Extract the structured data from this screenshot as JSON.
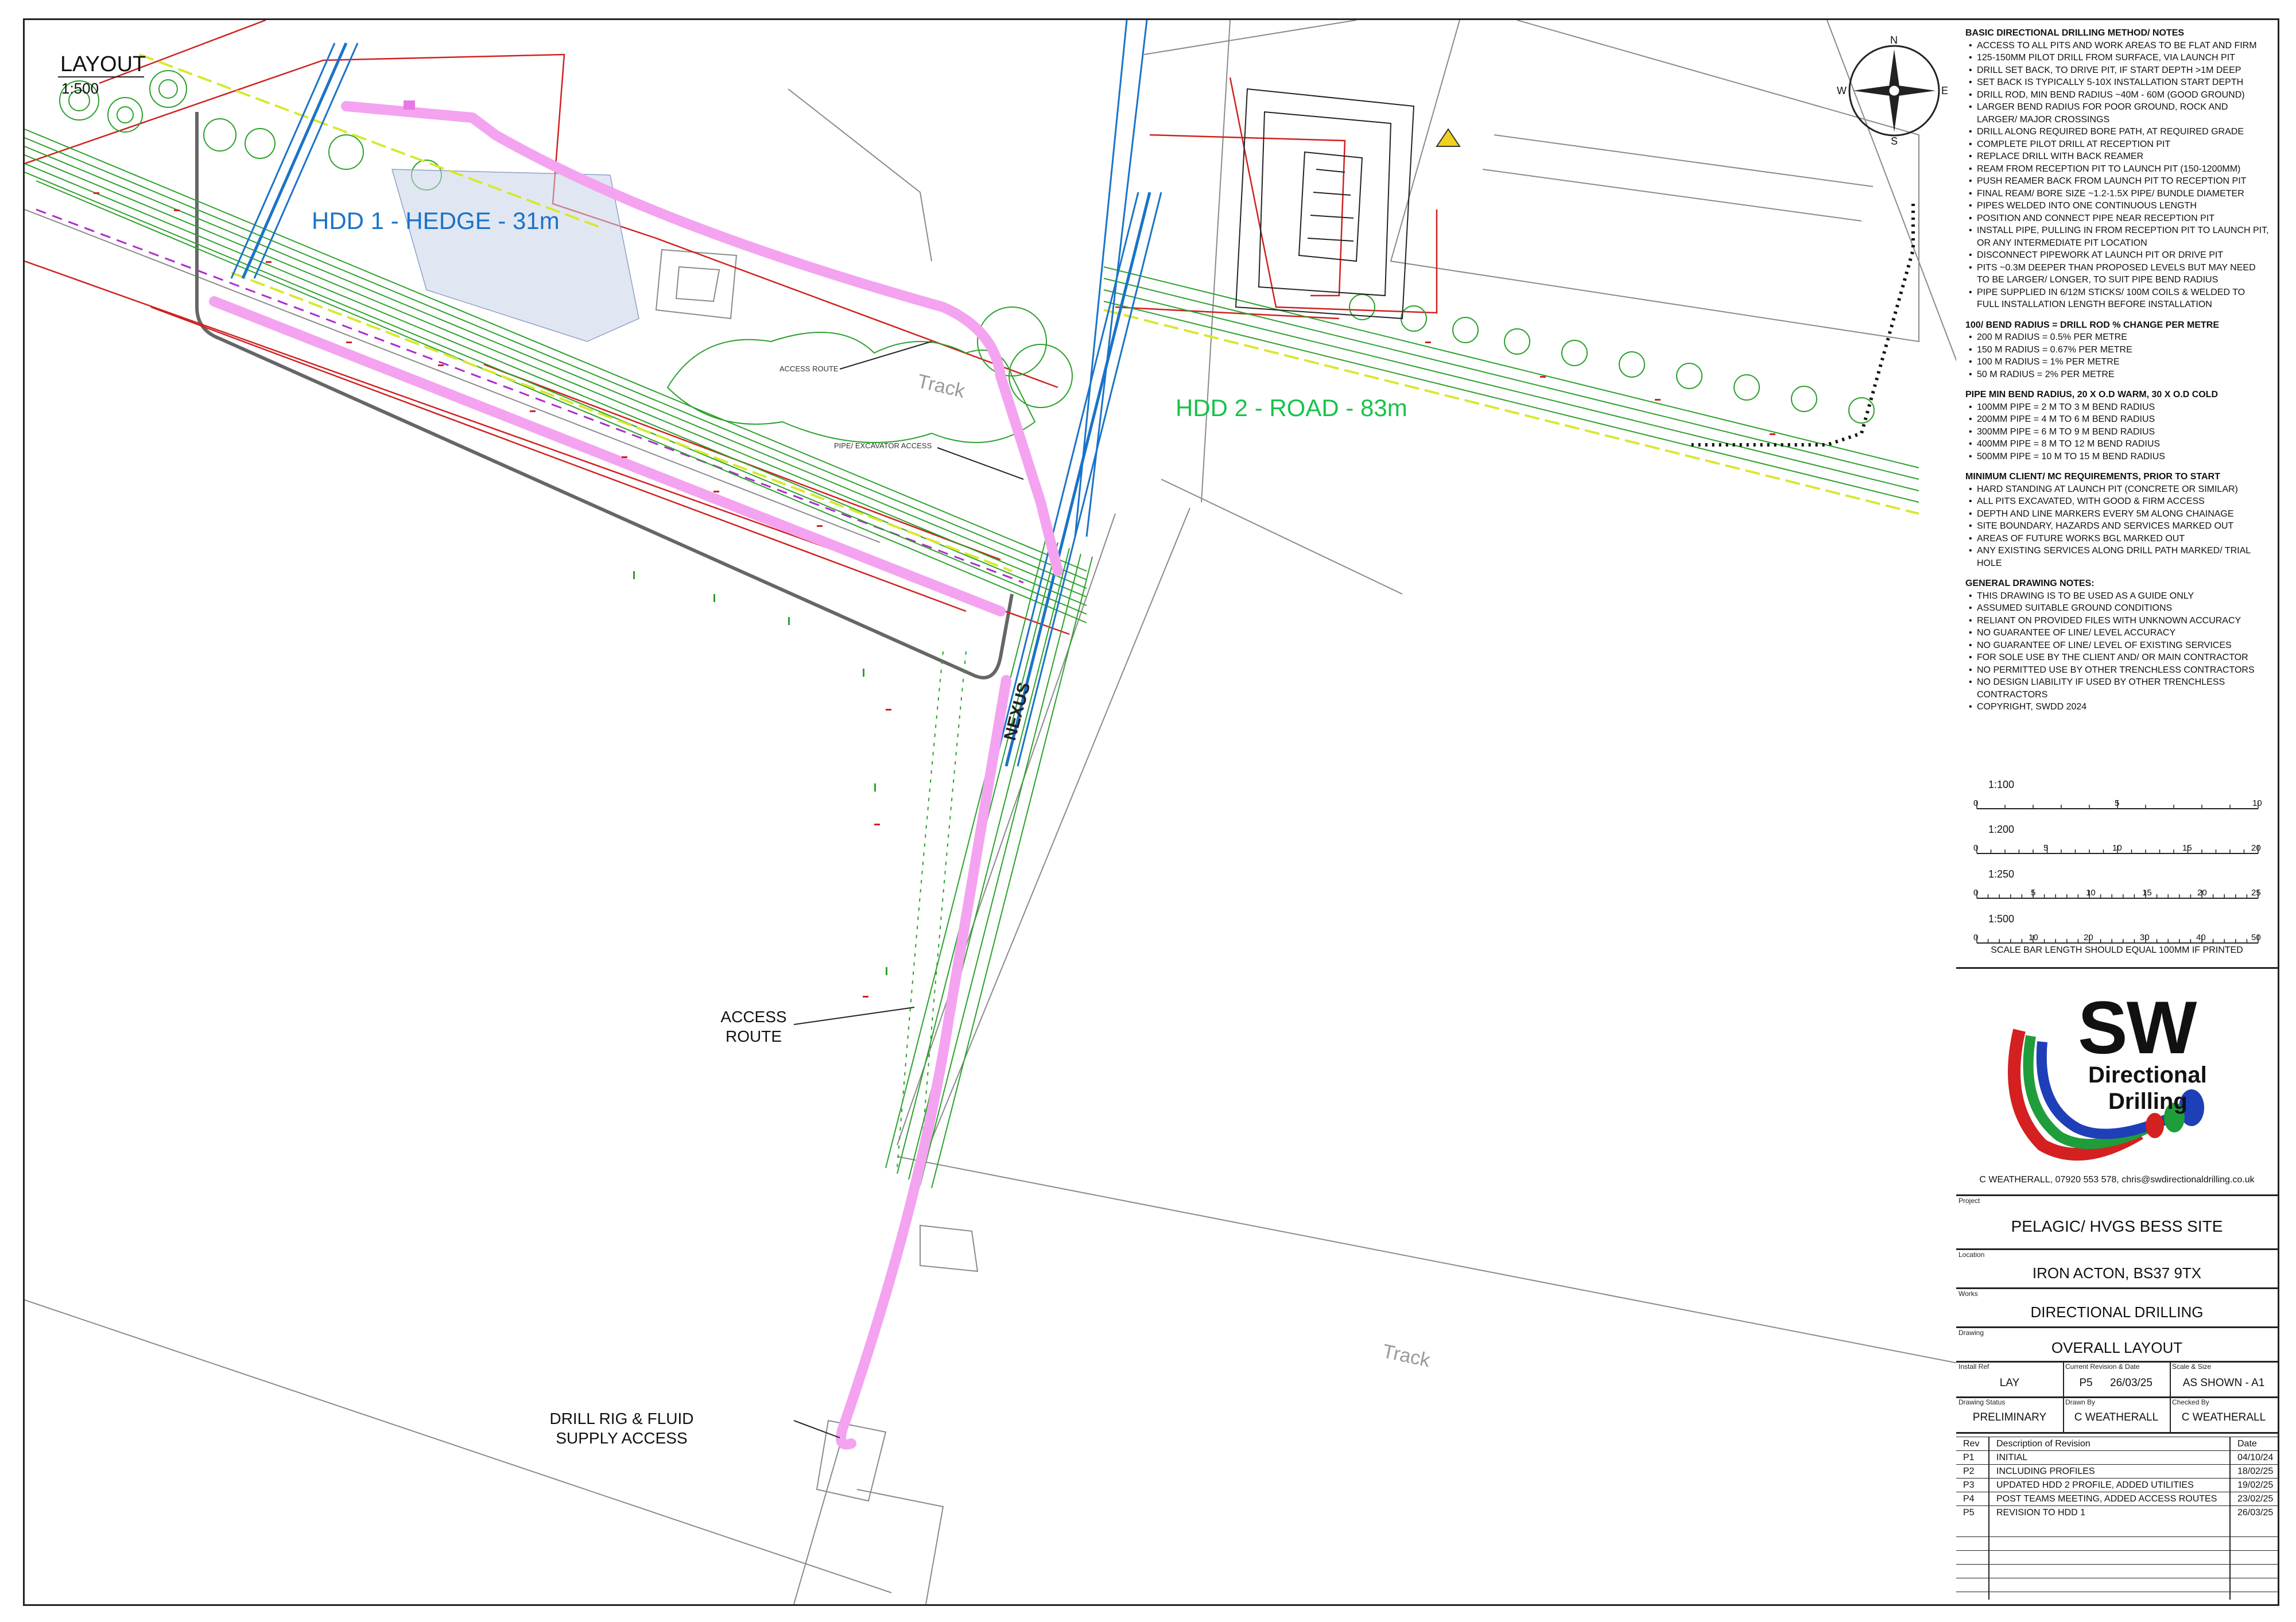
{
  "layout": {
    "title": "LAYOUT",
    "scale": "1:500"
  },
  "map_labels": {
    "hdd1": "HDD 1 - HEDGE - 31m",
    "hdd2": "HDD 2 - ROAD - 83m",
    "access_route_upper": "ACCESS ROUTE",
    "pipe_excavator_access": "PIPE/ EXCAVATOR ACCESS",
    "access_route_lower_1": "ACCESS",
    "access_route_lower_2": "ROUTE",
    "drill_rig_1": "DRILL RIG & FLUID",
    "drill_rig_2": "SUPPLY ACCESS",
    "track_upper": "Track",
    "track_lower": "Track",
    "nexus": "NEXUS"
  },
  "compass": {
    "n": "N",
    "s": "S",
    "e": "E",
    "w": "W"
  },
  "notes": [
    {
      "heading": "BASIC DIRECTIONAL DRILLING METHOD/ NOTES",
      "items": [
        "ACCESS TO ALL PITS AND WORK AREAS TO BE FLAT AND FIRM",
        "125-150MM PILOT DRILL FROM SURFACE, VIA LAUNCH PIT",
        "DRILL SET BACK, TO DRIVE PIT, IF START DEPTH >1M DEEP",
        "SET BACK IS TYPICALLY 5-10X INSTALLATION START DEPTH",
        "DRILL ROD, MIN BEND RADIUS ~40M - 60M (GOOD GROUND)",
        "LARGER BEND RADIUS FOR POOR GROUND, ROCK AND LARGER/ MAJOR CROSSINGS",
        "DRILL ALONG REQUIRED BORE PATH, AT REQUIRED GRADE",
        "COMPLETE PILOT DRILL AT RECEPTION PIT",
        "REPLACE DRILL WITH BACK REAMER",
        "REAM FROM RECEPTION PIT TO LAUNCH PIT (150-1200MM)",
        "PUSH REAMER BACK FROM LAUNCH PIT TO RECEPTION PIT",
        "FINAL REAM/ BORE SIZE ~1.2-1.5X PIPE/ BUNDLE DIAMETER",
        "PIPES WELDED INTO ONE CONTINUOUS LENGTH",
        "POSITION AND CONNECT PIPE NEAR RECEPTION PIT",
        "INSTALL PIPE, PULLING IN FROM RECEPTION PIT TO LAUNCH PIT, OR ANY INTERMEDIATE PIT LOCATION",
        "DISCONNECT PIPEWORK AT LAUNCH PIT OR DRIVE PIT",
        "PITS ~0.3M DEEPER THAN PROPOSED LEVELS BUT MAY NEED TO BE LARGER/ LONGER, TO SUIT PIPE BEND RADIUS",
        "PIPE SUPPLIED IN 6/12M STICKS/ 100M COILS & WELDED TO FULL INSTALLATION LENGTH BEFORE INSTALLATION"
      ]
    },
    {
      "heading": "100/ BEND RADIUS = DRILL ROD % CHANGE PER METRE",
      "items": [
        "200 M RADIUS = 0.5% PER METRE",
        "150 M RADIUS = 0.67% PER METRE",
        "100 M RADIUS = 1% PER METRE",
        "50 M RADIUS = 2% PER METRE"
      ]
    },
    {
      "heading": "PIPE MIN BEND RADIUS, 20 X O.D WARM, 30 X O.D COLD",
      "items": [
        "100MM PIPE = 2 M TO 3 M BEND RADIUS",
        "200MM PIPE = 4 M TO 6 M BEND RADIUS",
        "300MM PIPE = 6 M TO 9 M BEND RADIUS",
        "400MM PIPE = 8 M TO 12 M BEND RADIUS",
        "500MM PIPE = 10 M TO 15 M BEND RADIUS"
      ]
    },
    {
      "heading": "MINIMUM CLIENT/ MC REQUIREMENTS, PRIOR TO START",
      "items": [
        "HARD STANDING AT LAUNCH PIT (CONCRETE OR SIMILAR)",
        "ALL PITS EXCAVATED, WITH GOOD & FIRM ACCESS",
        "DEPTH AND LINE MARKERS EVERY 5M ALONG CHAINAGE",
        "SITE BOUNDARY,  HAZARDS AND SERVICES  MARKED OUT",
        "AREAS OF FUTURE WORKS BGL MARKED OUT",
        "ANY EXISTING SERVICES ALONG DRILL PATH MARKED/ TRIAL HOLE"
      ]
    },
    {
      "heading": "GENERAL DRAWING NOTES:",
      "items": [
        "THIS DRAWING IS TO BE USED AS A GUIDE ONLY",
        "ASSUMED SUITABLE GROUND CONDITIONS",
        "RELIANT ON PROVIDED FILES WITH UNKNOWN ACCURACY",
        "NO GUARANTEE OF LINE/ LEVEL ACCURACY",
        "NO GUARANTEE OF LINE/ LEVEL OF EXISTING SERVICES",
        "FOR SOLE USE BY THE CLIENT AND/ OR MAIN CONTRACTOR",
        "NO PERMITTED USE BY OTHER TRENCHLESS CONTRACTORS",
        "NO DESIGN LIABILITY IF USED BY OTHER TRENCHLESS CONTRACTORS",
        "COPYRIGHT, SWDD 2024"
      ]
    }
  ],
  "scale_bars": [
    {
      "label": "1:100",
      "ticks": [
        "0",
        "5",
        "10"
      ]
    },
    {
      "label": "1:200",
      "ticks": [
        "0",
        "5",
        "10",
        "15",
        "20"
      ]
    },
    {
      "label": "1:250",
      "ticks": [
        "0",
        "5",
        "10",
        "15",
        "20",
        "25"
      ]
    },
    {
      "label": "1:500",
      "ticks": [
        "0",
        "10",
        "20",
        "30",
        "40",
        "50"
      ]
    }
  ],
  "scale_note": "SCALE BAR LENGTH SHOULD EQUAL 100MM IF PRINTED",
  "logo": {
    "big": "SW",
    "line1": "Directional",
    "line2": "Drilling"
  },
  "contact": "C WEATHERALL, 07920 553 578, chris@swdirectionaldrilling.co.uk",
  "title_block": {
    "project_label": "Project",
    "project": "PELAGIC/ HVGS BESS SITE",
    "location_label": "Location",
    "location": "IRON ACTON, BS37 9TX",
    "works_label": "Works",
    "works": "DIRECTIONAL DRILLING",
    "drawing_label": "Drawing",
    "drawing": "OVERALL LAYOUT",
    "install_ref_label": "Install Ref",
    "install_ref": "LAY",
    "current_rev_label": "Current Revision & Date",
    "current_rev": "P5",
    "current_date": "26/03/25",
    "scale_size_label": "Scale & Size",
    "scale_size": "AS SHOWN - A1",
    "status_label": "Drawing Status",
    "status": "PRELIMINARY",
    "drawn_label": "Drawn By",
    "drawn": "C WEATHERALL",
    "checked_label": "Checked By",
    "checked": "C WEATHERALL"
  },
  "revisions": {
    "headers": [
      "Rev",
      "Description of Revision",
      "Date"
    ],
    "rows": [
      [
        "P1",
        "INITIAL",
        "04/10/24"
      ],
      [
        "P2",
        "INCLUDING PROFILES",
        "18/02/25"
      ],
      [
        "P3",
        "UPDATED HDD 2 PROFILE, ADDED UTILITIES",
        "19/02/25"
      ],
      [
        "P4",
        "POST TEAMS MEETING, ADDED ACCESS ROUTES",
        "23/02/25"
      ],
      [
        "P5",
        "REVISION TO HDD 1",
        "26/03/25"
      ]
    ]
  },
  "colors": {
    "access_route": "#f4a3f0",
    "hdd1": "#1a73c8",
    "hdd2": "#19c24a",
    "boundary_red": "#d02020",
    "vegetation": "#2aa12a",
    "utility_yellow": "#d8e830",
    "logo_red": "#d42020",
    "logo_green": "#1f9d3a",
    "logo_blue": "#1e3fb8"
  }
}
